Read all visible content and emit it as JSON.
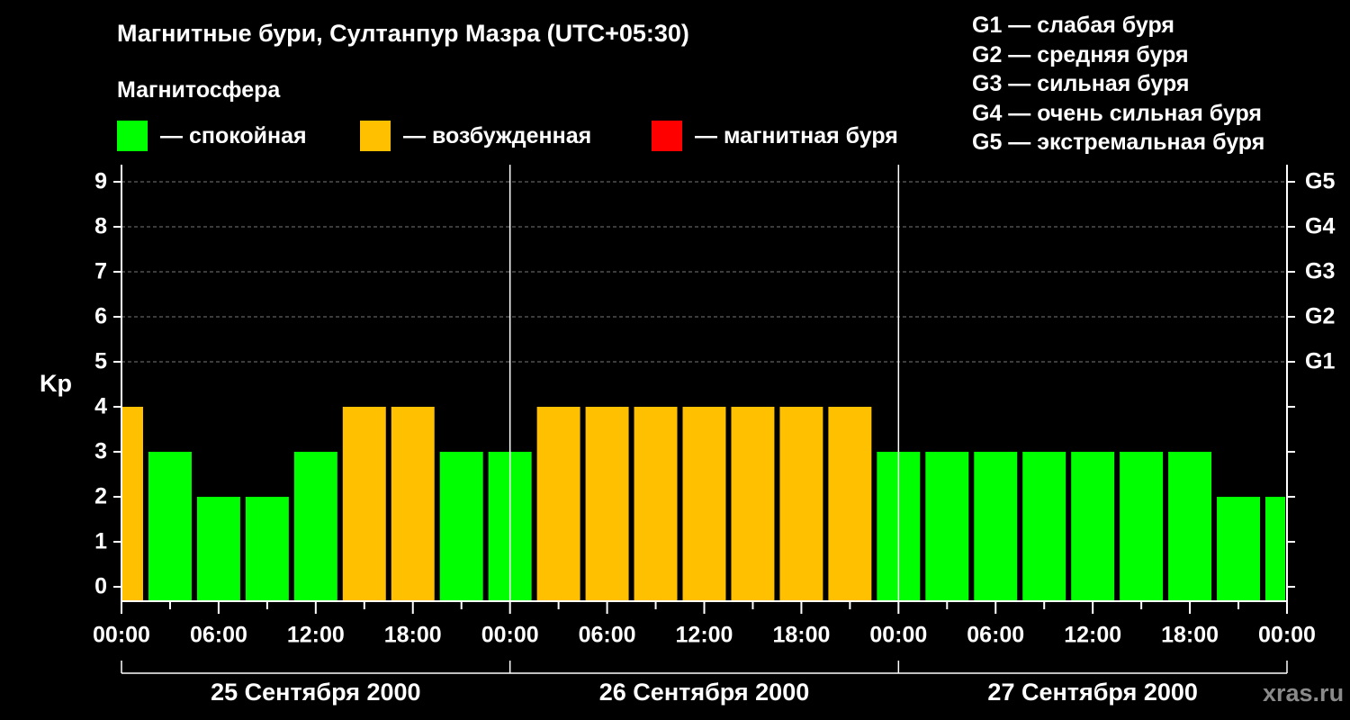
{
  "header": {
    "title": "Магнитные бури, Султанпур Мазра (UTC+05:30)",
    "subtitle": "Магнитосфера"
  },
  "legend": {
    "items": [
      {
        "label": "— спокойная",
        "color": "#00ff00"
      },
      {
        "label": "— возбужденная",
        "color": "#ffc000"
      },
      {
        "label": "— магнитная буря",
        "color": "#ff0000"
      }
    ]
  },
  "g_scale": [
    "G1 — слабая буря",
    "G2 — средняя буря",
    "G3 — сильная буря",
    "G4 — очень сильная буря",
    "G5 — экстремальная буря"
  ],
  "watermark": "xras.ru",
  "chart_data": {
    "type": "bar",
    "ylabel": "Kp",
    "ylim": [
      0,
      9
    ],
    "yticks": [
      "0",
      "1",
      "2",
      "3",
      "4",
      "5",
      "6",
      "7",
      "8",
      "9"
    ],
    "right_axis_labels": [
      {
        "kp": 5,
        "label": "G1"
      },
      {
        "kp": 6,
        "label": "G2"
      },
      {
        "kp": 7,
        "label": "G3"
      },
      {
        "kp": 8,
        "label": "G4"
      },
      {
        "kp": 9,
        "label": "G5"
      }
    ],
    "x_tick_labels": [
      "00:00",
      "06:00",
      "12:00",
      "18:00",
      "00:00",
      "06:00",
      "12:00",
      "18:00",
      "00:00",
      "06:00",
      "12:00",
      "18:00",
      "00:00"
    ],
    "days": [
      "25 Сентября 2000",
      "26 Сентября 2000",
      "27 Сентября 2000"
    ],
    "colors": {
      "quiet": "#00ff00",
      "disturbed": "#ffc000",
      "storm": "#ff0000"
    },
    "grid": true,
    "bars": [
      {
        "start": "25.09 00:00",
        "end": "25.09 01:30",
        "kp": 4,
        "level": "disturbed"
      },
      {
        "start": "25.09 01:30",
        "end": "25.09 04:30",
        "kp": 3,
        "level": "quiet"
      },
      {
        "start": "25.09 04:30",
        "end": "25.09 07:30",
        "kp": 2,
        "level": "quiet"
      },
      {
        "start": "25.09 07:30",
        "end": "25.09 10:30",
        "kp": 2,
        "level": "quiet"
      },
      {
        "start": "25.09 10:30",
        "end": "25.09 13:30",
        "kp": 3,
        "level": "quiet"
      },
      {
        "start": "25.09 13:30",
        "end": "25.09 16:30",
        "kp": 4,
        "level": "disturbed"
      },
      {
        "start": "25.09 16:30",
        "end": "25.09 19:30",
        "kp": 4,
        "level": "disturbed"
      },
      {
        "start": "25.09 19:30",
        "end": "25.09 22:30",
        "kp": 3,
        "level": "quiet"
      },
      {
        "start": "25.09 22:30",
        "end": "26.09 01:30",
        "kp": 3,
        "level": "quiet"
      },
      {
        "start": "26.09 01:30",
        "end": "26.09 04:30",
        "kp": 4,
        "level": "disturbed"
      },
      {
        "start": "26.09 04:30",
        "end": "26.09 07:30",
        "kp": 4,
        "level": "disturbed"
      },
      {
        "start": "26.09 07:30",
        "end": "26.09 10:30",
        "kp": 4,
        "level": "disturbed"
      },
      {
        "start": "26.09 10:30",
        "end": "26.09 13:30",
        "kp": 4,
        "level": "disturbed"
      },
      {
        "start": "26.09 13:30",
        "end": "26.09 16:30",
        "kp": 4,
        "level": "disturbed"
      },
      {
        "start": "26.09 16:30",
        "end": "26.09 19:30",
        "kp": 4,
        "level": "disturbed"
      },
      {
        "start": "26.09 19:30",
        "end": "26.09 22:30",
        "kp": 4,
        "level": "disturbed"
      },
      {
        "start": "26.09 22:30",
        "end": "27.09 01:30",
        "kp": 3,
        "level": "quiet"
      },
      {
        "start": "27.09 01:30",
        "end": "27.09 04:30",
        "kp": 3,
        "level": "quiet"
      },
      {
        "start": "27.09 04:30",
        "end": "27.09 07:30",
        "kp": 3,
        "level": "quiet"
      },
      {
        "start": "27.09 07:30",
        "end": "27.09 10:30",
        "kp": 3,
        "level": "quiet"
      },
      {
        "start": "27.09 10:30",
        "end": "27.09 13:30",
        "kp": 3,
        "level": "quiet"
      },
      {
        "start": "27.09 13:30",
        "end": "27.09 16:30",
        "kp": 3,
        "level": "quiet"
      },
      {
        "start": "27.09 16:30",
        "end": "27.09 19:30",
        "kp": 3,
        "level": "quiet"
      },
      {
        "start": "27.09 19:30",
        "end": "27.09 22:30",
        "kp": 2,
        "level": "quiet"
      },
      {
        "start": "27.09 22:30",
        "end": "28.09 00:00",
        "kp": 2,
        "level": "quiet"
      }
    ]
  }
}
